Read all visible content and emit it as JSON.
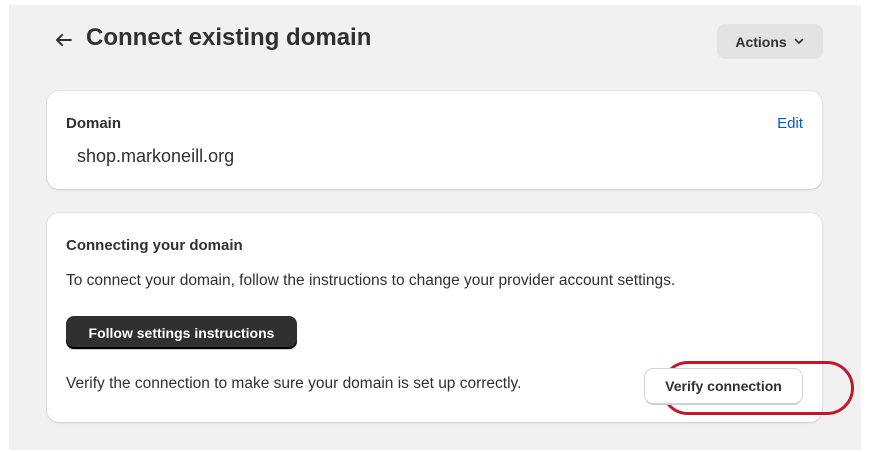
{
  "header": {
    "title": "Connect existing domain",
    "back_icon": "arrow-left-icon",
    "actions_label": "Actions",
    "actions_icon": "chevron-down-icon"
  },
  "domain_card": {
    "label": "Domain",
    "edit_label": "Edit",
    "domain": "shop.markoneill.org"
  },
  "connect_card": {
    "heading": "Connecting your domain",
    "instructions_text": "To connect your domain, follow the instructions to change your provider account settings.",
    "follow_button_label": "Follow settings instructions",
    "verify_text": "Verify the connection to make sure your domain is set up correctly.",
    "verify_button_label": "Verify connection"
  },
  "colors": {
    "background": "#f1f1f1",
    "link": "#005bd3",
    "primary_button": "#303030",
    "highlight_ring": "#c1182b"
  }
}
